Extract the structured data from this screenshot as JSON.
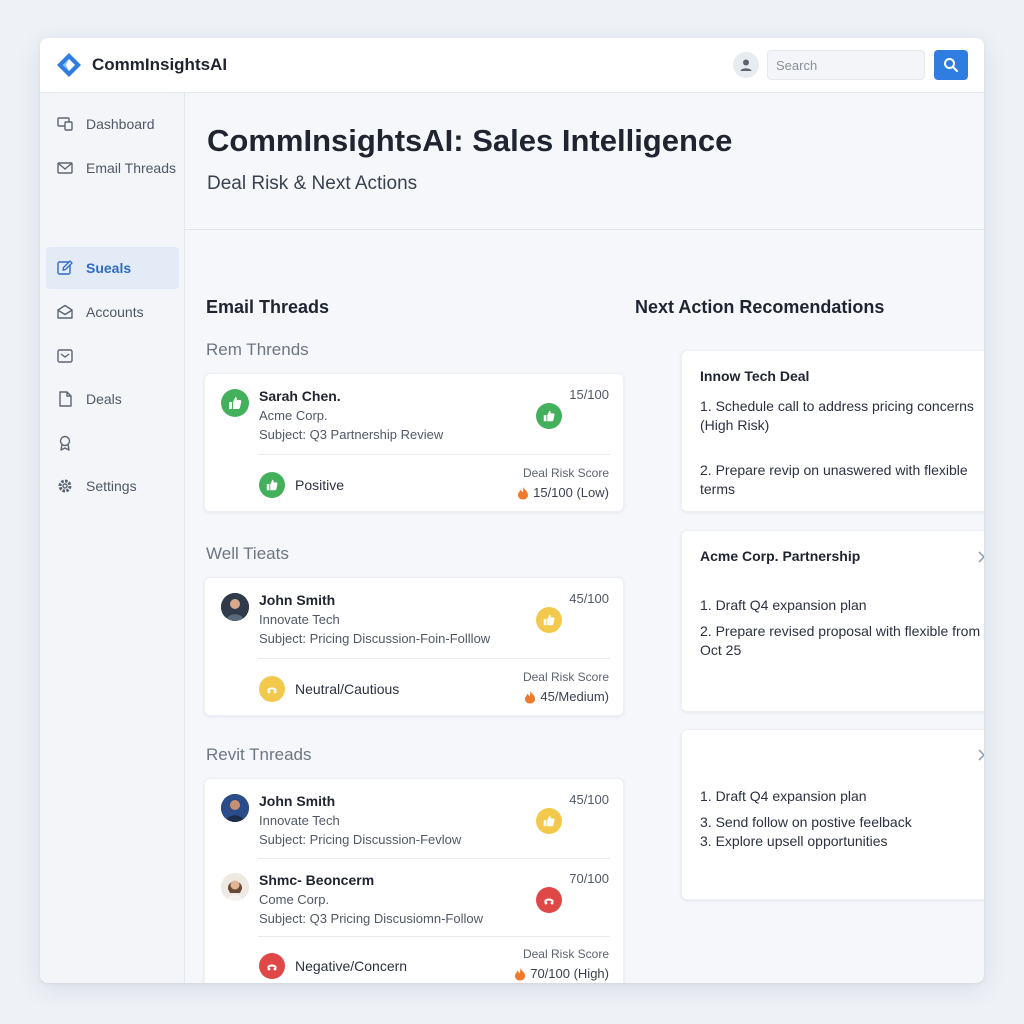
{
  "app": {
    "name": "CommInsightsAI"
  },
  "search": {
    "placeholder": "Search"
  },
  "sidebar": {
    "items": [
      {
        "label": "Dashboard",
        "icon": "dashboard-icon"
      },
      {
        "label": "Email Threads",
        "icon": "mail-icon"
      },
      {
        "label": "Sueals",
        "icon": "edit-icon",
        "active": true
      },
      {
        "label": "Accounts",
        "icon": "mail-open-icon"
      },
      {
        "label": "",
        "icon": "inbox-icon"
      },
      {
        "label": "Deals",
        "icon": "document-icon"
      },
      {
        "label": "",
        "icon": "award-icon"
      },
      {
        "label": "Settings",
        "icon": "gear-icon"
      }
    ]
  },
  "page": {
    "title": "CommInsightsAI: Sales Intelligence",
    "subtitle": "Deal Risk & Next Actions"
  },
  "threads_section": {
    "heading": "Email Threads",
    "groups": [
      {
        "label": "Rem Thrends",
        "threads": [
          {
            "name": "Sarah Chen.",
            "company": "Acme Corp.",
            "subject": "Subject: Q3 Partnership Review",
            "score": "15/100",
            "sentiment": "positive"
          }
        ],
        "summary": {
          "sentiment_label": "Positive",
          "risk_label": "Deal Risk Score",
          "risk_value": "15/100 (Low)",
          "sentiment": "positive"
        }
      },
      {
        "label": "Well Tieats",
        "threads": [
          {
            "name": "John Smith",
            "company": "Innovate Tech",
            "subject": "Subject: Pricing Discussion-Foin-Folllow",
            "score": "45/100",
            "sentiment": "neutral"
          }
        ],
        "summary": {
          "sentiment_label": "Neutral/Cautious",
          "risk_label": "Deal Risk Score",
          "risk_value": "45/Medium)",
          "sentiment": "neutral"
        }
      },
      {
        "label": "Revit Tnreads",
        "threads": [
          {
            "name": "John Smith",
            "company": "Innovate Tech",
            "subject": "Subject: Pricing Discussion-Fevlow",
            "score": "45/100",
            "sentiment": "neutral"
          },
          {
            "name": "Shmc- Beoncerm",
            "company": "Come Corp.",
            "subject": "Subject: Q3 Pricing Discusiomn-Follow",
            "score": "70/100",
            "sentiment": "negative"
          }
        ],
        "summary": {
          "sentiment_label": "Negative/Concern",
          "risk_label": "Deal Risk Score",
          "risk_value": "70/100 (High)",
          "sentiment": "negative"
        }
      }
    ]
  },
  "recommendations": {
    "heading": "Next Action Recomendations",
    "cards": [
      {
        "title": "Innow Tech Deal",
        "items": [
          "1. Schedule call to address pricing concerns (High Risk)",
          "2. Prepare revip on unaswered with flexible terms"
        ]
      },
      {
        "title": "Acme Corp. Partnership",
        "items": [
          "1. Draft Q4 expansion plan",
          "2. Prepare revised proposal with flexible from Oct 25"
        ]
      },
      {
        "title": "",
        "items": [
          "1. Draft Q4 expansion plan",
          "3. Send follow on postive feelback",
          "3. Explore upsell opportunities"
        ]
      }
    ]
  },
  "colors": {
    "accent": "#2f7de1",
    "positive": "#43b05c",
    "neutral": "#f2c94c",
    "negative": "#e04848",
    "risk_flame": "#f07a2b"
  }
}
